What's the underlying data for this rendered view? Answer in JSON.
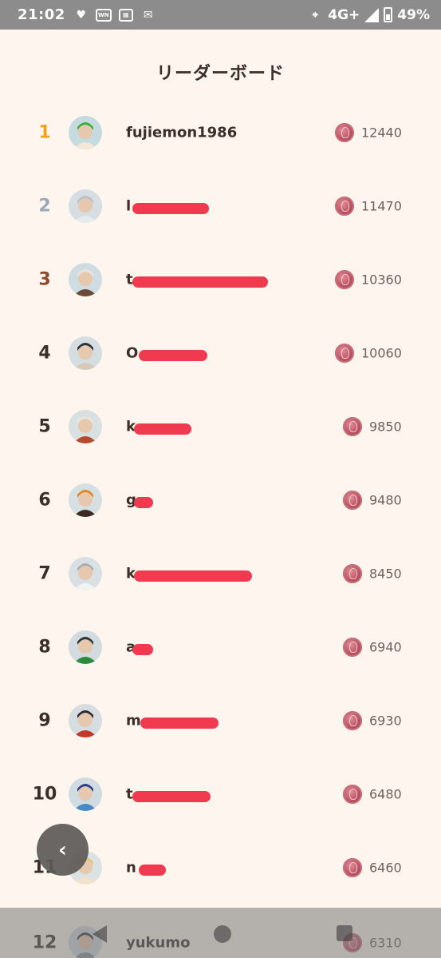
{
  "status_bar": {
    "time": "21:02",
    "network": "4G+",
    "battery": "49%",
    "left_icons": [
      "heart-pulse-icon",
      "wn-app-icon",
      "sim-icon",
      "mail-icon"
    ],
    "right_icons": [
      "location-icon",
      "signal-icon",
      "battery-icon"
    ]
  },
  "page": {
    "title": "リーダーボード"
  },
  "colors": {
    "background": "#fdf5ee",
    "rank_1": "#f0a11e",
    "rank_2": "#9aa8b8",
    "rank_3": "#8a4a2a",
    "default_rank": "#3b2f28",
    "redaction": "#f03a4f",
    "coin": "#b8505f"
  },
  "leaderboard": [
    {
      "rank": "1",
      "username": "fujiemon1986",
      "score": "12440",
      "avatar": "green-masked-hunter-avatar"
    },
    {
      "rank": "2",
      "username": "l",
      "score": "11470",
      "avatar": "silver-armored-avatar"
    },
    {
      "rank": "3",
      "username": "t",
      "score": "10360",
      "avatar": "white-hood-avatar"
    },
    {
      "rank": "4",
      "username": "O",
      "score": "10060",
      "avatar": "cat-ears-masked-avatar"
    },
    {
      "rank": "5",
      "username": "k",
      "score": "9850",
      "avatar": "white-helmet-avatar"
    },
    {
      "rank": "6",
      "username": "g",
      "score": "9480",
      "avatar": "orange-hair-avatar"
    },
    {
      "rank": "7",
      "username": "k",
      "score": "8450",
      "avatar": "grey-hair-avatar"
    },
    {
      "rank": "8",
      "username": "a",
      "score": "6940",
      "avatar": "dark-hat-avatar"
    },
    {
      "rank": "9",
      "username": "m",
      "score": "6930",
      "avatar": "witch-hat-avatar"
    },
    {
      "rank": "10",
      "username": "t",
      "score": "6480",
      "avatar": "blue-helmet-avatar"
    },
    {
      "rank": "11",
      "username": "n",
      "score": "6460",
      "avatar": "blonde-avatar"
    },
    {
      "rank": "12",
      "username": "yukumo",
      "score": "6310",
      "avatar": "dark-armor-avatar"
    }
  ],
  "back_button": {
    "icon": "chevron-left-icon",
    "glyph": "‹"
  }
}
